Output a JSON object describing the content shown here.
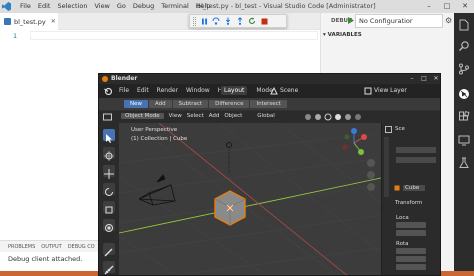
{
  "vscode": {
    "menu": [
      "File",
      "Edit",
      "Selection",
      "View",
      "Go",
      "Debug",
      "Terminal",
      "Help"
    ],
    "title": "bl_test.py - bl_test - Visual Studio Code [Administrator]",
    "window_controls": [
      "–",
      "□",
      "✕"
    ],
    "tab": {
      "label": "bl_test.py",
      "close": "✕"
    },
    "line_number": "1",
    "debug": {
      "section_label": "DEBUG",
      "config": "No Configuratior",
      "variables_header": "▾ VARIABLES"
    },
    "panel": {
      "tabs": [
        "PROBLEMS",
        "OUTPUT",
        "DEBUG CO"
      ],
      "text": "Debug client attached."
    },
    "colors": {
      "status_bar": "#cc6633",
      "activity_bar": "#2c2c2c"
    }
  },
  "blender": {
    "title": "Blender",
    "window_controls": [
      "–",
      "□",
      "✕"
    ],
    "menu": [
      "File",
      "Edit",
      "Render",
      "Window",
      "Help"
    ],
    "workspaces": [
      "Layout",
      "Mode"
    ],
    "scene": "Scene",
    "view_layer": "View Layer",
    "boolean_ops": [
      "New",
      "Add",
      "Subtract",
      "Difference",
      "Intersect"
    ],
    "header": {
      "mode": "Object Mode",
      "items": [
        "View",
        "Select",
        "Add",
        "Object"
      ],
      "transform": "Global"
    },
    "viewport": {
      "perspective": "User Perspective",
      "collection": "(1) Collection | Cube"
    },
    "outliner": {
      "scene_label": "Sce",
      "object_name": "Cube",
      "section": "Transform",
      "location_label": "Loca",
      "rotation_label": "Rota"
    },
    "colors": {
      "accent": "#4772b3",
      "selection": "#e87d0d"
    }
  }
}
